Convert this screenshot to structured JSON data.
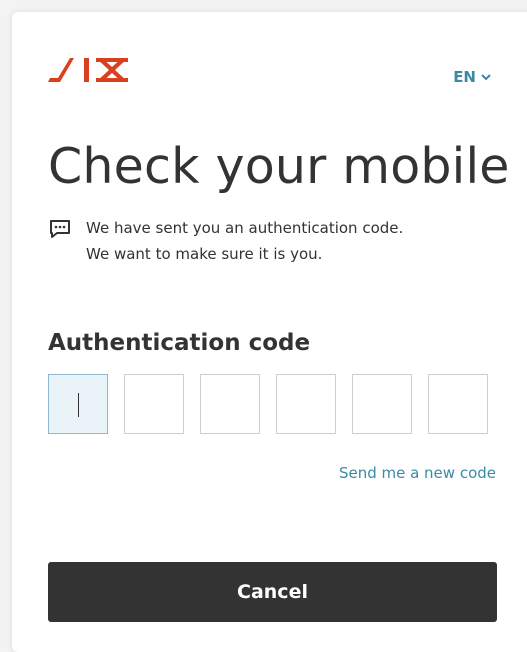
{
  "brand": {
    "logo_text": "SIX",
    "color": "#d9401f"
  },
  "language": {
    "label": "EN",
    "icon": "chevron-down-icon",
    "color": "#3a8aa6"
  },
  "title": "Check your mobile",
  "message": {
    "icon": "message-dots-icon",
    "line1": "We have sent you an authentication code.",
    "line2": "We want to make sure it is you."
  },
  "auth": {
    "label": "Authentication code",
    "digits": [
      "",
      "",
      "",
      "",
      "",
      ""
    ],
    "active_index": 0
  },
  "resend_link": "Send me a new code",
  "cancel_button": "Cancel"
}
